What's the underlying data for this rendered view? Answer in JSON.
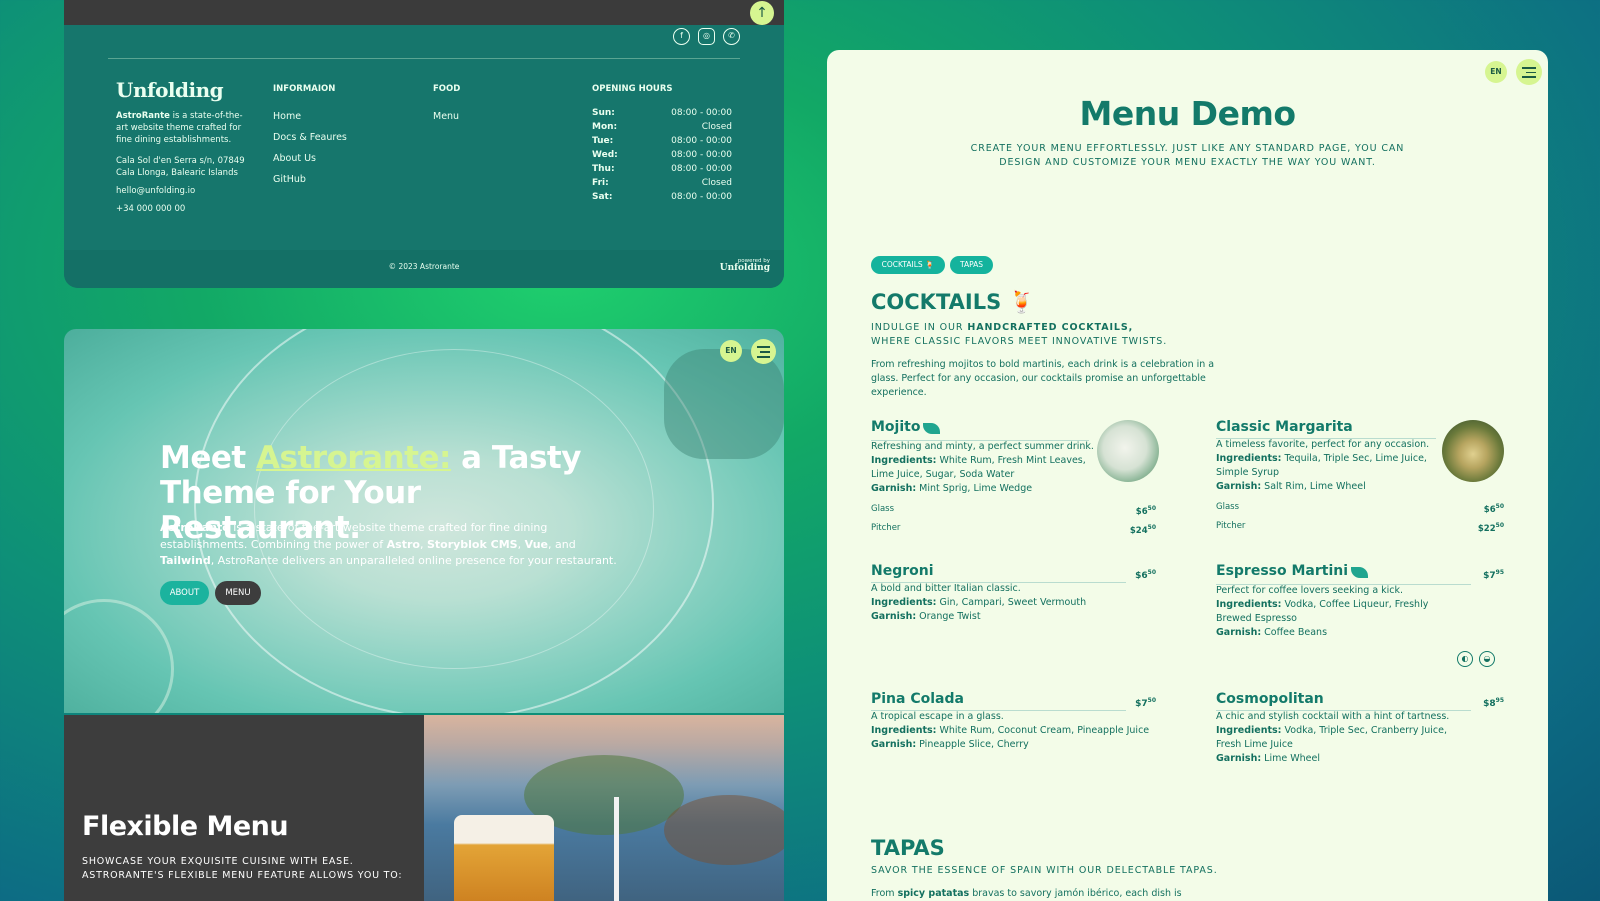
{
  "footer": {
    "logo": "Unfolding",
    "about_bold": "AstroRante",
    "about_rest": " is a state-of-the-art website theme crafted for fine dining establishments.",
    "address": "Cala Sol d'en Serra s/n, 07849 Cala Llonga, Balearic Islands",
    "email": "hello@unfolding.io",
    "phone": "+34 000 000 00",
    "info_heading": "INFORMAION",
    "info_links": [
      "Home",
      "Docs & Feaures",
      "About Us",
      "GitHub"
    ],
    "food_heading": "FOOD",
    "food_links": [
      "Menu"
    ],
    "hours_heading": "OPENING HOURS",
    "hours": [
      {
        "day": "Sun:",
        "time": "08:00 - 00:00"
      },
      {
        "day": "Mon:",
        "time": "Closed"
      },
      {
        "day": "Tue:",
        "time": "08:00 - 00:00"
      },
      {
        "day": "Wed:",
        "time": "08:00 - 00:00"
      },
      {
        "day": "Thu:",
        "time": "08:00 - 00:00"
      },
      {
        "day": "Fri:",
        "time": "Closed"
      },
      {
        "day": "Sat:",
        "time": "08:00 - 00:00"
      }
    ],
    "copyright": "© 2023 Astrorante",
    "powered_label": "powered by",
    "powered_brand": "Unfolding",
    "social_icons": [
      "facebook-icon",
      "instagram-icon",
      "whatsapp-icon"
    ]
  },
  "hero": {
    "lang": "EN",
    "title_pre": "Meet ",
    "title_brand": "Astrorante:",
    "title_post": " a Tasty Theme for Your Restaurant.",
    "desc_1": "AstroRante",
    "desc_2": " is a state-of-the-art website theme crafted for fine dining establishments. Combining the power of ",
    "desc_3": "Astro",
    "desc_4": ", ",
    "desc_5": "Storyblok CMS",
    "desc_6": ", ",
    "desc_7": "Vue",
    "desc_8": ", and ",
    "desc_9": "Tailwind",
    "desc_10": ", AstroRante delivers an unparalleled online presence for your restaurant.",
    "about_btn": "ABOUT",
    "menu_btn": "MENU"
  },
  "flex": {
    "title": "Flexible Menu",
    "subtitle": "SHOWCASE YOUR EXQUISITE CUISINE WITH EASE. ASTRORANTE'S FLEXIBLE MENU FEATURE ALLOWS YOU TO:"
  },
  "demo": {
    "lang": "EN",
    "title": "Menu Demo",
    "intro": "CREATE YOUR MENU EFFORTLESSLY. JUST LIKE ANY STANDARD PAGE, YOU CAN DESIGN AND CUSTOMIZE YOUR MENU EXACTLY THE WAY YOU WANT.",
    "tabs": [
      "COCKTAILS 🍹",
      "TAPAS"
    ],
    "cocktails_title": "COCKTAILS 🍹",
    "cocktails_sub_1": "INDULGE IN OUR ",
    "cocktails_sub_bold": "HANDCRAFTED COCKTAILS,",
    "cocktails_sub_2": "WHERE CLASSIC FLAVORS MEET INNOVATIVE TWISTS.",
    "cocktails_desc": "From refreshing mojitos to bold martinis, each drink is a celebration in a glass. Perfect for any occasion, our cocktails promise an unforgettable experience.",
    "ingredients_label": "Ingredients:",
    "garnish_label": "Garnish:",
    "items": [
      {
        "name": "Mojito",
        "desc": "Refreshing and minty, a perfect summer drink.",
        "ingredients": " White Rum, Fresh Mint Leaves, Lime Juice, Sugar, Soda Water",
        "garnish": " Mint Sprig, Lime Wedge",
        "options": [
          {
            "label": "Glass",
            "price": "$6",
            "cents": "50"
          },
          {
            "label": "Pitcher",
            "price": "$24",
            "cents": "50"
          }
        ]
      },
      {
        "name": "Classic Margarita",
        "desc": "A timeless favorite, perfect for any occasion.",
        "ingredients": " Tequila, Triple Sec, Lime Juice, Simple Syrup",
        "garnish": " Salt Rim, Lime Wheel",
        "options": [
          {
            "label": "Glass",
            "price": "$6",
            "cents": "50"
          },
          {
            "label": "Pitcher",
            "price": "$22",
            "cents": "50"
          }
        ]
      },
      {
        "name": "Negroni",
        "price": "$6",
        "cents": "50",
        "desc": "A bold and bitter Italian classic.",
        "ingredients": " Gin, Campari, Sweet Vermouth",
        "garnish": " Orange Twist"
      },
      {
        "name": "Espresso Martini",
        "price": "$7",
        "cents": "95",
        "desc": "Perfect for coffee lovers seeking a kick.",
        "ingredients": " Vodka, Coffee Liqueur, Freshly Brewed Espresso",
        "garnish": " Coffee Beans"
      },
      {
        "name": "Pina Colada",
        "price": "$7",
        "cents": "50",
        "desc": "A tropical escape in a glass.",
        "ingredients": " White Rum, Coconut Cream, Pineapple Juice",
        "garnish": " Pineapple Slice, Cherry"
      },
      {
        "name": "Cosmopolitan",
        "price": "$8",
        "cents": "95",
        "desc": "A chic and stylish cocktail with a hint of tartness.",
        "ingredients": " Vodka, Triple Sec, Cranberry Juice, Fresh Lime Juice",
        "garnish": " Lime Wheel"
      }
    ],
    "tapas_title": "TAPAS",
    "tapas_sub": "SAVOR THE ESSENCE OF SPAIN WITH OUR DELECTABLE TAPAS.",
    "tapas_desc_1": "From ",
    "tapas_desc_bold": "spicy patatas",
    "tapas_desc_2": " bravas to savory jamón ibérico, each dish is",
    "colors": {
      "accent": "#d6f591",
      "teal": "#13705f",
      "pill": "#14b39d",
      "card": "#f3fce8"
    }
  }
}
